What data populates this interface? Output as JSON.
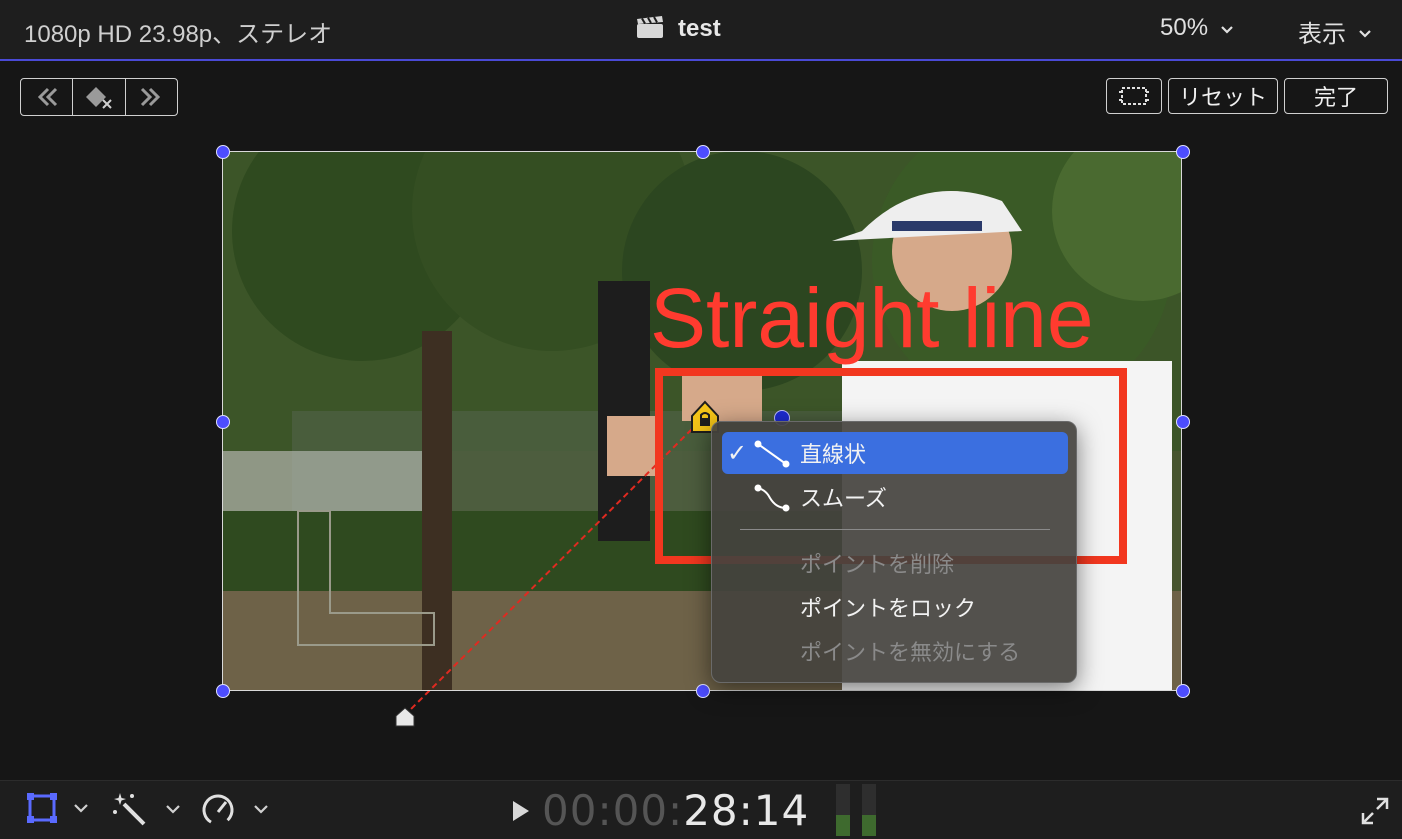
{
  "topbar": {
    "format": "1080p HD 23.98p、ステレオ",
    "project_title": "test",
    "zoom": "50%",
    "view_menu": "表示"
  },
  "toolbar": {
    "reset_label": "リセット",
    "done_label": "完了"
  },
  "annotation": {
    "text": "Straight line",
    "color": "#f2371f"
  },
  "context_menu": {
    "items": [
      {
        "label": "直線状",
        "checked": true,
        "selected": true,
        "enabled": true
      },
      {
        "label": "スムーズ",
        "checked": false,
        "selected": false,
        "enabled": true
      },
      {
        "label": "ポイントを削除",
        "enabled": false
      },
      {
        "label": "ポイントをロック",
        "enabled": true
      },
      {
        "label": "ポイントを無効にする",
        "enabled": false
      }
    ]
  },
  "timecode": {
    "dim": "00:00:",
    "bright": "28:14"
  },
  "colors": {
    "accent": "#4d4dff",
    "menu_highlight": "#3b6fe0",
    "keyframe": "#f5c518"
  }
}
